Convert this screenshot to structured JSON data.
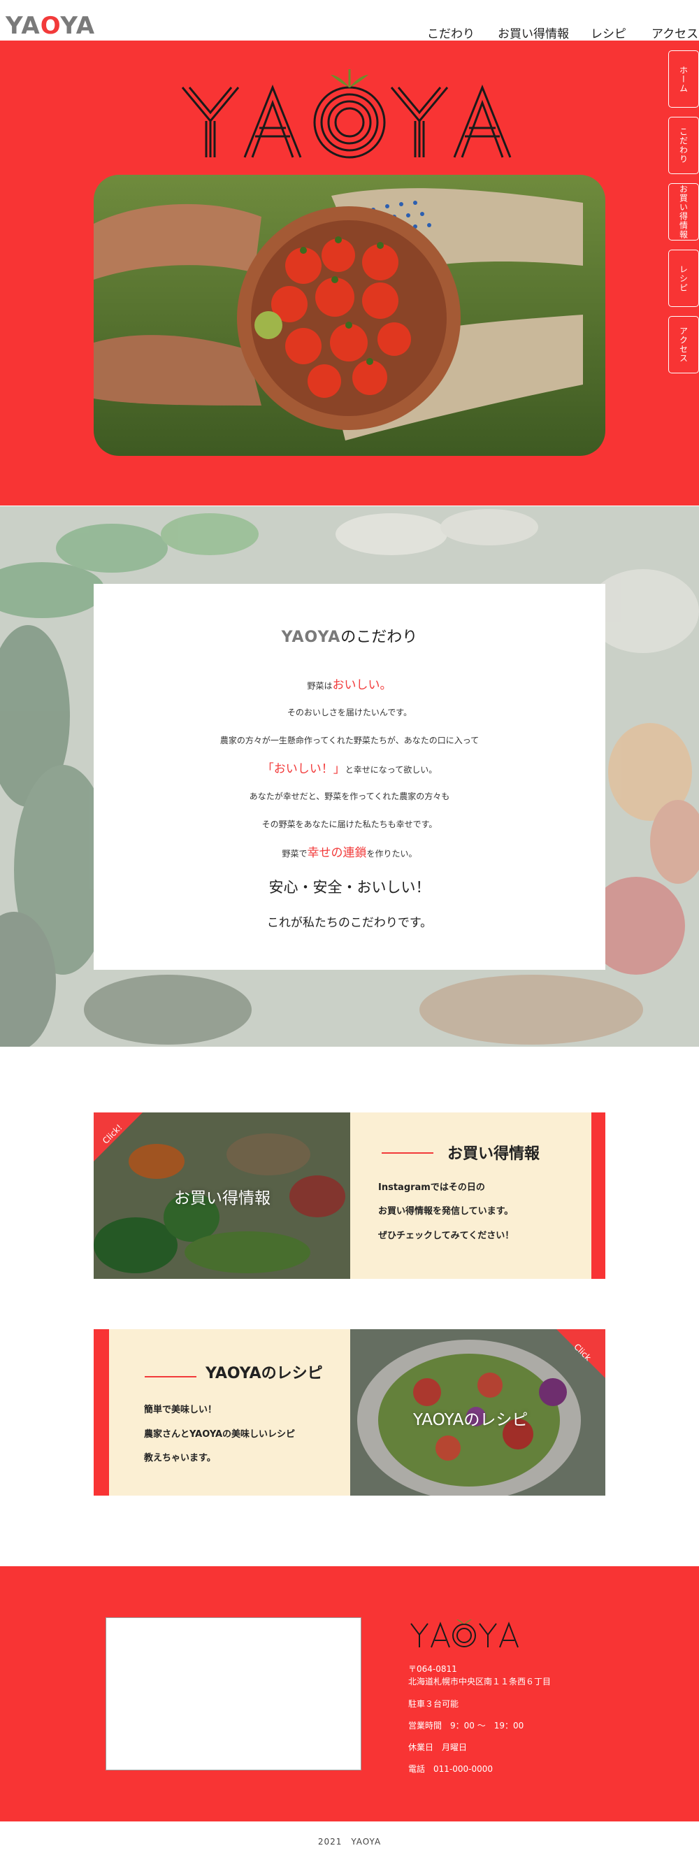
{
  "header": {
    "logo_prefix": "YA",
    "logo_o": "O",
    "logo_suffix": "YA",
    "nav": [
      "こだわり",
      "お買い得情報",
      "レシピ",
      "アクセス"
    ]
  },
  "hero": {
    "logo": "YAOYA"
  },
  "side_nav": [
    "ホーム",
    "こだわり",
    "お買い得情報",
    "レシピ",
    "アクセス"
  ],
  "kodawari": {
    "title_prefix": "YAOYA",
    "title_suffix": "のこだわり",
    "line1_a": "野菜は",
    "line1_b": "おいしい。",
    "line2": "そのおいしさを届けたいんです。",
    "line3": "農家の方々が一生懸命作ってくれた野菜たちが、あなたの口に入って",
    "line4_a": "「おいしい！」",
    "line4_b": "と幸せになって欲しい。",
    "line5": "あなたが幸せだと、野菜を作ってくれた農家の方々も",
    "line6": "その野菜をあなたに届けた私たちも幸せです。",
    "line7_a": "野菜で",
    "line7_b": "幸せの連鎖",
    "line7_c": "を作りたい。",
    "line8": "安心・安全・おいしい！",
    "line9": "これが私たちのこだわりです。"
  },
  "deals": {
    "badge": "Click!",
    "image_label": "お買い得情報",
    "title": "お買い得情報",
    "lines": [
      "Instagramではその日の",
      "お買い得情報を発信しています。",
      "ぜひチェックしてみてください！"
    ]
  },
  "recipe": {
    "badge": "Click",
    "image_label": "YAOYAのレシピ",
    "title": "YAOYAのレシピ",
    "lines": [
      "簡単で美味しい！",
      "農家さんとYAOYAの美味しいレシピ",
      "教えちゃいます。"
    ]
  },
  "footer": {
    "logo": "YAOYA",
    "postal": "〒064-0811",
    "address": "北海道札幌市中央区南１１条西６丁目",
    "parking": "駐車３台可能",
    "hours": "営業時間　9：00 〜　19：00",
    "holiday": "休業日　月曜日",
    "phone": "電話　011-000-0000",
    "copyright": "2021　YAOYA"
  },
  "colors": {
    "brand_red": "#f83434",
    "cream": "#fbefd3",
    "logo_grey": "#7a7a7a"
  }
}
